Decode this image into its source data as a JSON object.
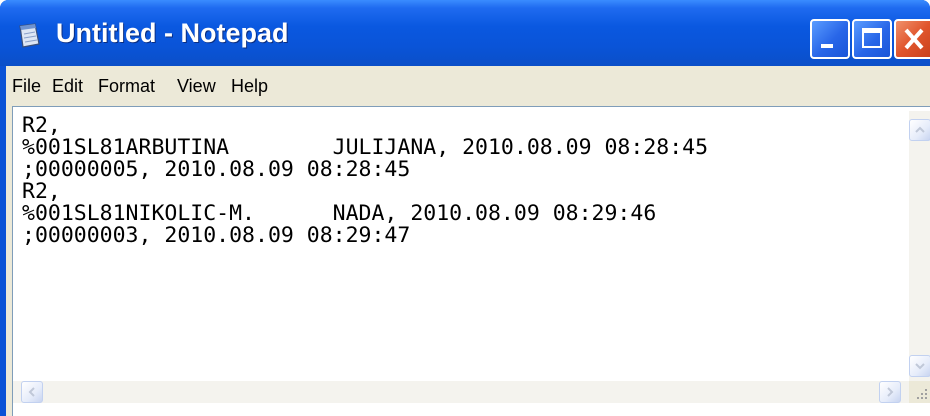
{
  "window": {
    "title": "Untitled - Notepad",
    "colors": {
      "titlebar": "#0a54d8",
      "close_button": "#e0552c",
      "frame": "#ece9d8"
    }
  },
  "menu": {
    "items": [
      "File",
      "Edit",
      "Format",
      "View",
      "Help"
    ]
  },
  "editor": {
    "lines": [
      "R2,",
      "%001SL81ARBUTINA        JULIJANA, 2010.08.09 08:28:45",
      ";00000005, 2010.08.09 08:28:45",
      "R2,",
      "%001SL81NIKOLIC-M.      NADA, 2010.08.09 08:29:46",
      ";00000003, 2010.08.09 08:29:47"
    ]
  },
  "icons": {
    "app": "notepad-icon",
    "minimize": "minimize-icon",
    "maximize": "maximize-icon",
    "close": "close-icon",
    "scroll_up": "arrow-up-icon",
    "scroll_down": "arrow-down-icon",
    "scroll_left": "arrow-left-icon",
    "scroll_right": "arrow-right-icon",
    "resize_grip": "resize-grip-icon"
  }
}
